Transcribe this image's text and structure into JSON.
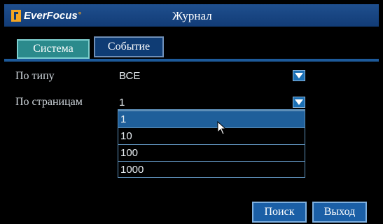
{
  "title_bar": {
    "logo_text": "EverFocus",
    "logo_mark_suffix": "°",
    "title": "Журнал"
  },
  "tabs": [
    {
      "label": "Система",
      "active": true
    },
    {
      "label": "Событие",
      "active": false
    }
  ],
  "filters": {
    "type": {
      "label": "По типу",
      "value": "ВСЕ"
    },
    "pages": {
      "label": "По страницам",
      "value": "1"
    }
  },
  "dropdown": {
    "options": [
      "1",
      "10",
      "100",
      "1000"
    ],
    "selected_index": 0
  },
  "buttons": {
    "search": "Поиск",
    "exit": "Выход"
  },
  "icons": {
    "dropdown": "chevron-down-icon",
    "cursor": "mouse-pointer-icon",
    "logo": "everfocus-logo"
  },
  "colors": {
    "title_bar": "#123c76",
    "tab_active": "#2b8a8c",
    "tab_inactive": "#0f3c74",
    "button": "#1b5fa6",
    "selected_option": "#1f5f9a"
  }
}
